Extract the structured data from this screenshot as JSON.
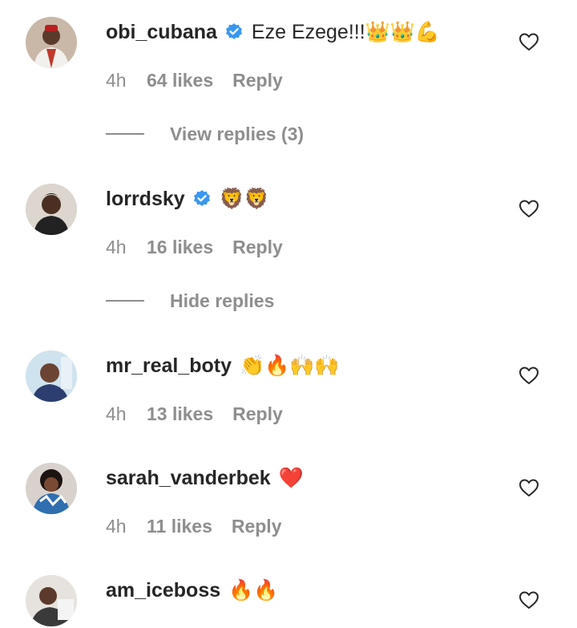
{
  "comments": [
    {
      "username": "obi_cubana",
      "verified": true,
      "text": "Eze Ezege!!!👑👑💪",
      "time": "4h",
      "likes": "64 likes",
      "reply": "Reply",
      "replies_toggle": "View replies (3)"
    },
    {
      "username": "lorrdsky",
      "verified": true,
      "text": "🦁🦁",
      "time": "4h",
      "likes": "16 likes",
      "reply": "Reply",
      "replies_toggle": "Hide replies"
    },
    {
      "username": "mr_real_boty",
      "verified": false,
      "text": "👏🔥🙌🙌",
      "time": "4h",
      "likes": "13 likes",
      "reply": "Reply"
    },
    {
      "username": "sarah_vanderbek",
      "verified": false,
      "text": "❤️",
      "time": "4h",
      "likes": "11 likes",
      "reply": "Reply"
    },
    {
      "username": "am_iceboss",
      "verified": false,
      "text": "🔥🔥"
    }
  ],
  "icons": {
    "verified": "verified-badge-icon",
    "like": "heart-outline-icon"
  },
  "colors": {
    "verified_badge": "#3897f0",
    "muted_text": "#8e8e8e",
    "primary_text": "#262626"
  }
}
